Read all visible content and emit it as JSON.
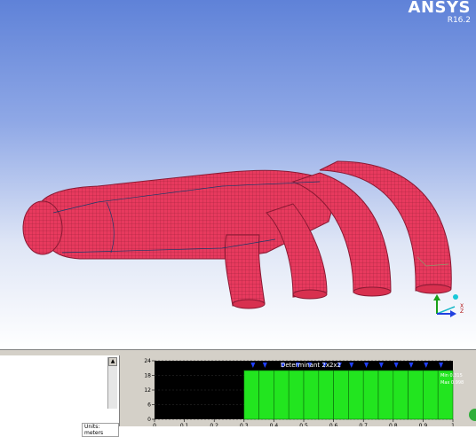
{
  "app": {
    "name": "ANSYS",
    "version": "R16.2"
  },
  "messages": {
    "units_label": "Units: meters"
  },
  "chart_data": {
    "type": "bar",
    "title": "Determinant 2x2x2",
    "xlabel": "",
    "ylabel": "",
    "xticks": [
      "0",
      "0.1",
      "0.2",
      "0.3",
      "0.4",
      "0.5",
      "0.6",
      "0.7",
      "0.8",
      "0.9",
      "1"
    ],
    "yticks": [
      "0",
      "6",
      "12",
      "18",
      "24"
    ],
    "xlim": [
      0,
      1
    ],
    "ylim": [
      0,
      24
    ],
    "bins": [
      {
        "x0": 0.3,
        "x1": 0.35,
        "value": 20
      },
      {
        "x0": 0.35,
        "x1": 0.4,
        "value": 20
      },
      {
        "x0": 0.4,
        "x1": 0.45,
        "value": 20
      },
      {
        "x0": 0.45,
        "x1": 0.5,
        "value": 20
      },
      {
        "x0": 0.5,
        "x1": 0.55,
        "value": 20
      },
      {
        "x0": 0.55,
        "x1": 0.6,
        "value": 20
      },
      {
        "x0": 0.6,
        "x1": 0.65,
        "value": 20
      },
      {
        "x0": 0.65,
        "x1": 0.7,
        "value": 20
      },
      {
        "x0": 0.7,
        "x1": 0.75,
        "value": 20
      },
      {
        "x0": 0.75,
        "x1": 0.8,
        "value": 20
      },
      {
        "x0": 0.8,
        "x1": 0.85,
        "value": 20
      },
      {
        "x0": 0.85,
        "x1": 0.9,
        "value": 20
      },
      {
        "x0": 0.9,
        "x1": 0.95,
        "value": 20
      },
      {
        "x0": 0.95,
        "x1": 1.0,
        "value": 20
      }
    ],
    "markers": [
      0.33,
      0.37,
      0.43,
      0.48,
      0.52,
      0.57,
      0.62,
      0.66,
      0.71,
      0.76,
      0.81,
      0.86,
      0.91,
      0.96
    ],
    "min_label": "Min 0.315",
    "max_label": "Max 0.998",
    "colors": {
      "background": "#000000",
      "bar": "#22e51f",
      "marker": "#2040ff",
      "text": "#ffffff"
    }
  },
  "axis_triad": {
    "x": "X",
    "y": "Y",
    "z": "Z"
  }
}
